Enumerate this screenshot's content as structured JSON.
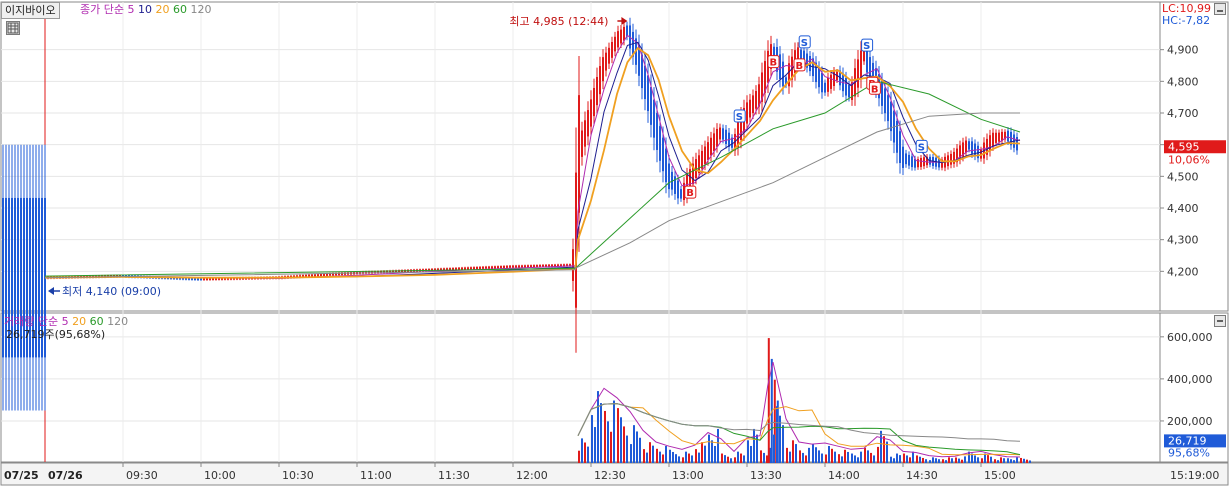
{
  "window": {
    "title": "이지바이오",
    "price_ma_label": "종가 단순",
    "price_ma_periods": [
      "5",
      "10",
      "20",
      "60",
      "120"
    ],
    "volume_label": "거래량",
    "volume_ma_label": "단순",
    "volume_ma_periods": [
      "5",
      "20",
      "60",
      "120"
    ],
    "volume_info": "26,719주(95,68%)",
    "lc": "LC:10,99",
    "hc": "HC:-7,82"
  },
  "icons": [
    "table-grid-icon",
    "minimize-icon",
    "maximize-icon"
  ],
  "colors": {
    "up": "#e01a1a",
    "down": "#1f5bd8",
    "ma5": "#b02bb0",
    "ma10": "#1e1e8f",
    "ma20": "#f0a020",
    "ma60": "#2a9a2a",
    "ma120": "#888888",
    "price_tag": "#e01a1a",
    "volume_tag": "#1f5bd8"
  },
  "chart_data": {
    "type": "line",
    "title": "이지바이오",
    "x_axis": {
      "date_labels": [
        "07/25",
        "07/26"
      ],
      "time_labels": [
        "09:30",
        "10:00",
        "10:30",
        "11:00",
        "11:30",
        "12:00",
        "12:30",
        "13:00",
        "13:30",
        "14:00",
        "14:30",
        "15:00",
        "15:19:00"
      ]
    },
    "price": {
      "y_ticks": [
        "4,200",
        "4,300",
        "4,400",
        "4,500",
        "4,600",
        "4,700",
        "4,800",
        "4,900"
      ],
      "ylim": [
        4100,
        5000
      ],
      "current": "4,595",
      "current_change": "10,06%",
      "high_annotation": "최고 4,985 (12:44)",
      "low_annotation": "최저 4,140 (09:00)",
      "series_close": [
        [
          "09:00",
          4180
        ],
        [
          "09:30",
          4185
        ],
        [
          "10:00",
          4175
        ],
        [
          "10:30",
          4180
        ],
        [
          "11:00",
          4195
        ],
        [
          "11:30",
          4205
        ],
        [
          "12:00",
          4215
        ],
        [
          "12:24",
          4220
        ],
        [
          "12:25",
          4560
        ],
        [
          "12:30",
          4700
        ],
        [
          "12:35",
          4850
        ],
        [
          "12:40",
          4930
        ],
        [
          "12:44",
          4960
        ],
        [
          "12:48",
          4880
        ],
        [
          "12:52",
          4760
        ],
        [
          "12:56",
          4620
        ],
        [
          "13:00",
          4500
        ],
        [
          "13:05",
          4440
        ],
        [
          "13:10",
          4520
        ],
        [
          "13:15",
          4580
        ],
        [
          "13:20",
          4640
        ],
        [
          "13:25",
          4600
        ],
        [
          "13:30",
          4700
        ],
        [
          "13:35",
          4760
        ],
        [
          "13:40",
          4900
        ],
        [
          "13:45",
          4800
        ],
        [
          "13:50",
          4890
        ],
        [
          "13:55",
          4850
        ],
        [
          "14:00",
          4780
        ],
        [
          "14:05",
          4820
        ],
        [
          "14:10",
          4760
        ],
        [
          "14:15",
          4880
        ],
        [
          "14:20",
          4800
        ],
        [
          "14:25",
          4700
        ],
        [
          "14:30",
          4560
        ],
        [
          "14:35",
          4540
        ],
        [
          "14:40",
          4550
        ],
        [
          "14:45",
          4540
        ],
        [
          "14:50",
          4560
        ],
        [
          "14:55",
          4600
        ],
        [
          "15:00",
          4570
        ],
        [
          "15:05",
          4620
        ],
        [
          "15:10",
          4630
        ],
        [
          "15:15",
          4595
        ]
      ],
      "ma60": [
        [
          "12:24",
          4210
        ],
        [
          "12:40",
          4330
        ],
        [
          "13:00",
          4480
        ],
        [
          "13:20",
          4560
        ],
        [
          "13:40",
          4650
        ],
        [
          "14:00",
          4700
        ],
        [
          "14:20",
          4800
        ],
        [
          "14:40",
          4760
        ],
        [
          "15:00",
          4680
        ],
        [
          "15:15",
          4640
        ]
      ],
      "ma120": [
        [
          "12:24",
          4210
        ],
        [
          "12:45",
          4290
        ],
        [
          "13:00",
          4360
        ],
        [
          "13:20",
          4420
        ],
        [
          "13:40",
          4480
        ],
        [
          "14:00",
          4560
        ],
        [
          "14:20",
          4640
        ],
        [
          "14:40",
          4690
        ],
        [
          "15:00",
          4700
        ],
        [
          "15:15",
          4700
        ]
      ],
      "signals": [
        {
          "type": "S",
          "time": "13:27"
        },
        {
          "type": "S",
          "time": "13:52"
        },
        {
          "type": "S",
          "time": "14:16"
        },
        {
          "type": "S",
          "time": "14:37"
        },
        {
          "type": "B",
          "time": "13:08"
        },
        {
          "type": "B",
          "time": "13:40"
        },
        {
          "type": "B",
          "time": "13:50"
        },
        {
          "type": "B",
          "time": "14:18"
        },
        {
          "type": "B",
          "time": "14:19"
        }
      ]
    },
    "volume": {
      "y_ticks": [
        "200,000",
        "400,000",
        "600,000"
      ],
      "ylim": [
        0,
        680000
      ],
      "current": "26,719",
      "current_pct": "95,68%",
      "series": [
        [
          "12:25",
          130000
        ],
        [
          "12:30",
          380000
        ],
        [
          "12:35",
          330000
        ],
        [
          "12:40",
          290000
        ],
        [
          "12:45",
          200000
        ],
        [
          "12:50",
          110000
        ],
        [
          "12:55",
          90000
        ],
        [
          "13:00",
          70000
        ],
        [
          "13:05",
          60000
        ],
        [
          "13:10",
          110000
        ],
        [
          "13:15",
          180000
        ],
        [
          "13:20",
          50000
        ],
        [
          "13:25",
          60000
        ],
        [
          "13:30",
          180000
        ],
        [
          "13:35",
          80000
        ],
        [
          "13:38",
          660000
        ],
        [
          "13:40",
          300000
        ],
        [
          "13:45",
          120000
        ],
        [
          "13:50",
          80000
        ],
        [
          "13:55",
          100000
        ],
        [
          "14:00",
          90000
        ],
        [
          "14:05",
          70000
        ],
        [
          "14:10",
          60000
        ],
        [
          "14:15",
          80000
        ],
        [
          "14:20",
          170000
        ],
        [
          "14:25",
          50000
        ],
        [
          "14:30",
          60000
        ],
        [
          "14:35",
          40000
        ],
        [
          "14:40",
          30000
        ],
        [
          "14:45",
          30000
        ],
        [
          "14:50",
          35000
        ],
        [
          "14:55",
          60000
        ],
        [
          "15:00",
          50000
        ],
        [
          "15:05",
          30000
        ],
        [
          "15:10",
          30000
        ],
        [
          "15:15",
          26719
        ]
      ]
    }
  }
}
